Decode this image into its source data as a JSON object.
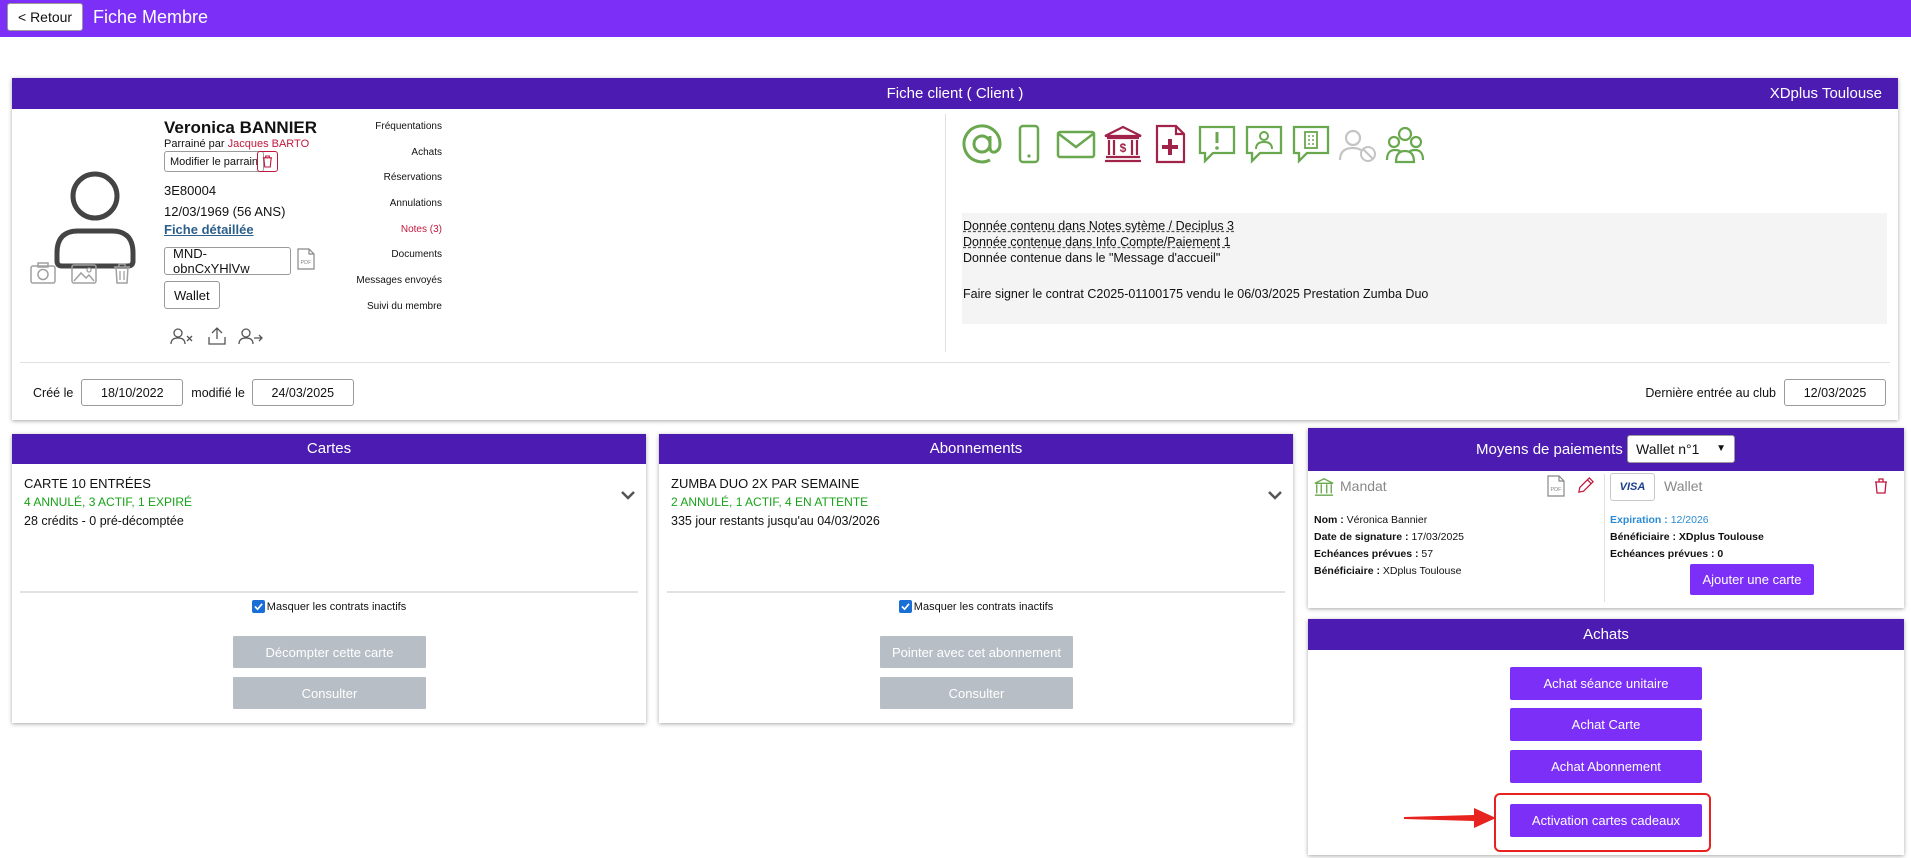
{
  "topbar": {
    "back_label": "< Retour",
    "title": "Fiche Membre"
  },
  "fiche": {
    "header": "Fiche client ( Client )",
    "club": "XDplus Toulouse",
    "member": {
      "name": "Veronica BANNIER",
      "parrain_prefix": "Parrainé par",
      "parrain_name": "Jacques BARTO",
      "modify_parrain": "Modifier le parrain",
      "code": "3E80004",
      "birth": "12/03/1969 (56 ANS)",
      "detail_link": "Fiche détaillée",
      "mandate_ref": "MND-obnCxYHlVw",
      "wallet_btn": "Wallet"
    },
    "menu": [
      "Fréquentations",
      "Achats",
      "Réservations",
      "Annulations",
      "Notes (3)",
      "Documents",
      "Messages envoyés",
      "Suivi du membre"
    ],
    "info_lines": [
      "Donnée contenu dans Notes sytème / Deciplus 3",
      "Donnée contenue dans Info Compte/Paiement 1",
      "Donnée contenue dans le \"Message d'accueil\"",
      "",
      "Faire signer le contrat C2025-01100175 vendu le 06/03/2025 Prestation Zumba Duo"
    ],
    "created_label": "Créé le",
    "created_date": "18/10/2022",
    "modified_label": "modifié le",
    "modified_date": "24/03/2025",
    "last_entry_label": "Dernière entrée au club",
    "last_entry_date": "12/03/2025"
  },
  "cartes": {
    "header": "Cartes",
    "title": "CARTE 10 ENTRÉES",
    "status": "4 ANNULÉ, 3 ACTIF, 1 EXPIRÉ",
    "extra": "28 crédits - 0 pré-décomptée",
    "masquer": "Masquer les contrats inactifs",
    "btn_primary": "Décompter cette carte",
    "btn_secondary": "Consulter"
  },
  "abonnements": {
    "header": "Abonnements",
    "title": "ZUMBA DUO 2X PAR SEMAINE",
    "status": "2 ANNULÉ, 1 ACTIF, 4 EN ATTENTE",
    "extra": "335 jour restants jusqu'au 04/03/2026",
    "masquer": "Masquer les contrats inactifs",
    "btn_primary": "Pointer avec cet abonnement",
    "btn_secondary": "Consulter"
  },
  "moyens": {
    "header": "Moyens de paiements",
    "wallet_select": "Wallet n°1",
    "mandat": {
      "label": "Mandat",
      "nom_label": "Nom :",
      "nom": "Véronica Bannier",
      "signature_label": "Date de signature :",
      "signature": "17/03/2025",
      "echeances_label": "Echéances prévues :",
      "echeances": "57",
      "beneficiaire_label": "Bénéficiaire :",
      "beneficiaire": "XDplus Toulouse"
    },
    "wallet": {
      "visa": "VISA",
      "label": "Wallet",
      "expiration_label": "Expiration :",
      "expiration": "12/2026",
      "beneficiaire_label": "Bénéficiaire :",
      "beneficiaire": "XDplus Toulouse",
      "echeances_label": "Echéances prévues :",
      "echeances": "0",
      "add_card": "Ajouter une carte"
    }
  },
  "achats": {
    "header": "Achats",
    "buttons": [
      "Achat séance unitaire",
      "Achat Carte",
      "Achat Abonnement",
      "Activation cartes cadeaux"
    ]
  },
  "colors": {
    "topbar": "#7b2ff7",
    "panel_header": "#4c1bb1",
    "accent_green": "#6aa84f",
    "accent_red": "#c0183d",
    "highlight": "#e8231f"
  }
}
